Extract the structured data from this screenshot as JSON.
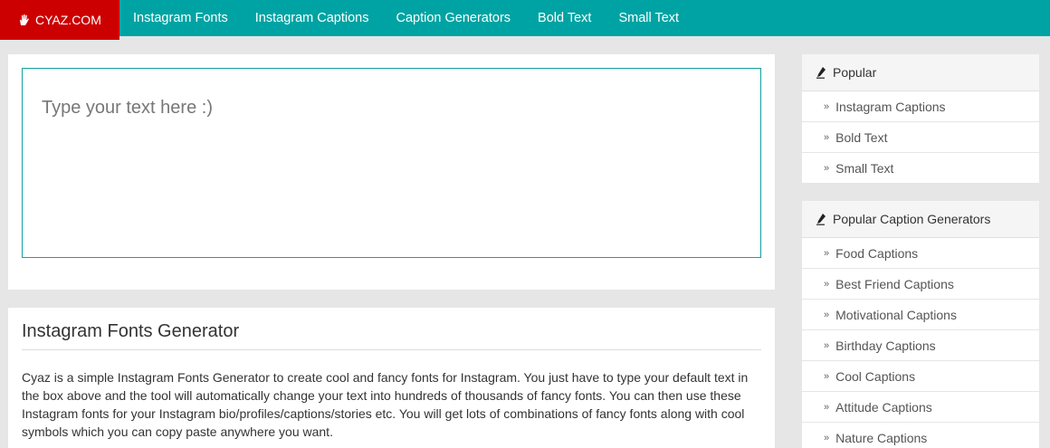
{
  "nav": {
    "brand": "CYAZ.COM",
    "links": [
      "Instagram Fonts",
      "Instagram Captions",
      "Caption Generators",
      "Bold Text",
      "Small Text"
    ]
  },
  "editor": {
    "placeholder": "Type your text here :)"
  },
  "info": {
    "title": "Instagram Fonts Generator",
    "body": "Cyaz is a simple Instagram Fonts Generator to create cool and fancy fonts for Instagram. You just have to type your default text in the box above and the tool will automatically change your text into hundreds of thousands of fancy fonts. You can then use these Instagram fonts for your Instagram bio/profiles/captions/stories etc. You will get lots of combinations of fancy fonts along with cool symbols which you can copy paste anywhere you want."
  },
  "sidebar": {
    "popular": {
      "title": "Popular",
      "items": [
        "Instagram Captions",
        "Bold Text",
        "Small Text"
      ]
    },
    "generators": {
      "title": "Popular Caption Generators",
      "items": [
        "Food Captions",
        "Best Friend Captions",
        "Motivational Captions",
        "Birthday Captions",
        "Cool Captions",
        "Attitude Captions",
        "Nature Captions"
      ]
    }
  },
  "colors": {
    "navbar": "#00a3a3",
    "brand": "#cc0000",
    "editor_border": "#16a0a0"
  },
  "icons": {
    "brand": "hand-icon",
    "side_head": "pen-icon",
    "side_item": "double-chevron-right-icon"
  }
}
